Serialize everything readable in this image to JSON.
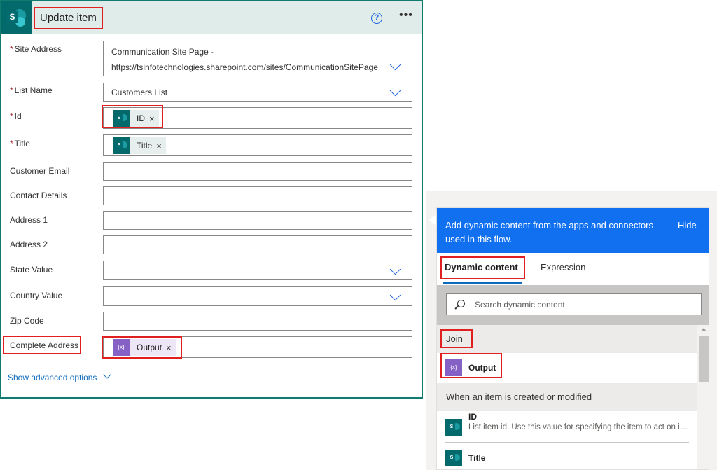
{
  "card": {
    "title": "Update item",
    "help_glyph": "?",
    "more_glyph": "•••",
    "logo_letter": "S",
    "fields": {
      "site_address": {
        "label": "Site Address",
        "value_line1": "Communication Site Page -",
        "value_line2": "https://tsinfotechnologies.sharepoint.com/sites/CommunicationSitePage"
      },
      "list_name": {
        "label": "List Name",
        "value": "Customers List"
      },
      "id": {
        "label": "Id",
        "token": "ID"
      },
      "title": {
        "label": "Title",
        "token": "Title"
      },
      "customer_email": {
        "label": "Customer Email"
      },
      "contact_details": {
        "label": "Contact Details"
      },
      "address1": {
        "label": "Address 1"
      },
      "address2": {
        "label": "Address 2"
      },
      "state_value": {
        "label": "State Value"
      },
      "country_value": {
        "label": "Country Value"
      },
      "zip_code": {
        "label": "Zip Code"
      },
      "complete_address": {
        "label": "Complete Address",
        "token": "Output"
      }
    },
    "required_mark": "*",
    "token_remove": "×",
    "token_fx": "{x}",
    "advanced_link": "Show advanced options"
  },
  "panel": {
    "header_text": "Add dynamic content from the apps and connectors used in this flow.",
    "hide_label": "Hide",
    "tabs": [
      {
        "label": "Dynamic content",
        "active": true
      },
      {
        "label": "Expression",
        "active": false
      }
    ],
    "search_placeholder": "Search dynamic content",
    "sections": [
      {
        "header": "Join",
        "items": [
          {
            "title": "Output",
            "icon": "expression-icon"
          }
        ]
      },
      {
        "header": "When an item is created or modified",
        "items": [
          {
            "title": "ID",
            "description": "List item id. Use this value for specifying the item to act on in other list related actions.",
            "icon": "sharepoint-icon"
          },
          {
            "title": "Title",
            "icon": "sharepoint-icon"
          }
        ]
      }
    ]
  },
  "colors": {
    "accent": "#117b6f",
    "panel_header": "#1070f0",
    "highlight_red": "#e02020",
    "link": "#0f6cbd"
  }
}
